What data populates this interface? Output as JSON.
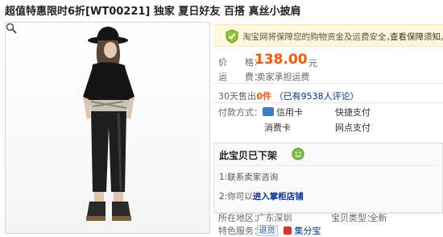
{
  "title": "超值特惠限时6折[WT00221] 独家  夏日好友 百搭  真丝小披肩",
  "icons": {
    "zoom": "magnifier-icon",
    "shield": "shield-icon",
    "smile": "smile-icon"
  },
  "colors": {
    "price": "#ff5500",
    "link": "#003399",
    "guarantee_bg": "#fff8dc"
  },
  "guarantee": {
    "text": "淘宝网将保障您的购物资金及运费安全，",
    "link": "查看保障须知。"
  },
  "price": {
    "label": "价　　格：",
    "value": "138.00",
    "unit": "元"
  },
  "shipping": {
    "label": "运　　费：",
    "value": "卖家承担运费"
  },
  "sales": {
    "label": "30天售出：",
    "count": "0件",
    "reviews": "（已有9538人评论）"
  },
  "payment": {
    "label": "付款方式：",
    "methods": [
      "信用卡",
      "快捷支付",
      "消费卡",
      "网点支付"
    ]
  },
  "offline": {
    "heading": "此宝贝已下架",
    "option1": "1:联系卖家咨询",
    "option2_prefix": "2:你可以",
    "option2_link": "进入掌柜店铺"
  },
  "details": {
    "location_label": "所在地区：",
    "location": "广东深圳",
    "type_label": "宝贝类型：",
    "type": "全新",
    "services_label": "特色服务：",
    "services": [
      "退货",
      "集分宝"
    ]
  }
}
